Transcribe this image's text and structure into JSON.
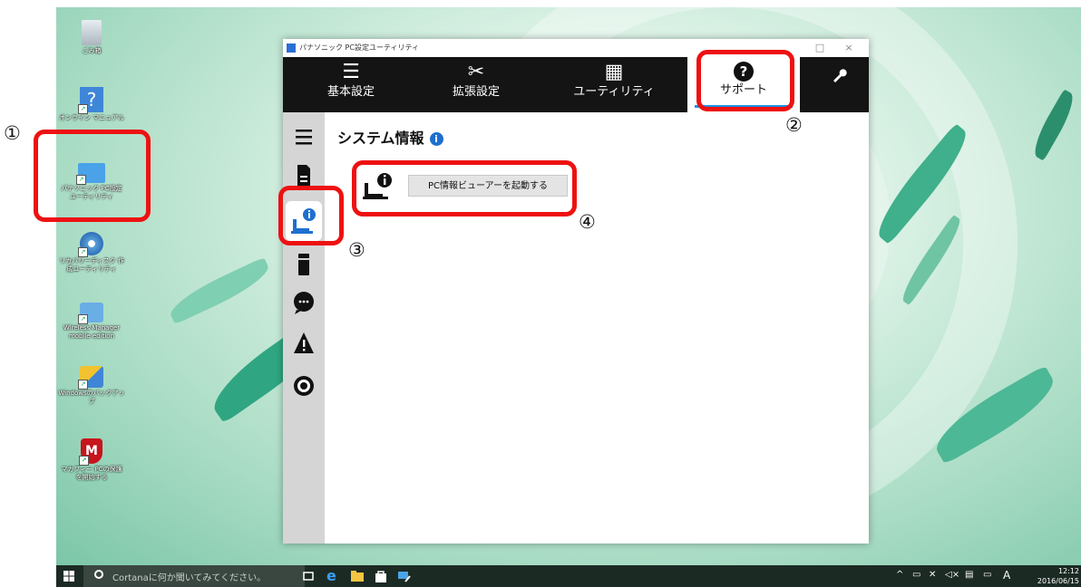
{
  "app": {
    "title": "パナソニック PC設定ユーティリティ",
    "window_controls": {
      "maximize": "□",
      "close": "×"
    }
  },
  "tabs": [
    {
      "label": "基本設定",
      "icon": "sliders-icon",
      "glyph": "☰"
    },
    {
      "label": "拡張設定",
      "icon": "tools-icon",
      "glyph": "✂"
    },
    {
      "label": "ユーティリティ",
      "icon": "grid-icon",
      "glyph": "▦"
    },
    {
      "label": "サポート",
      "icon": "question-icon",
      "glyph": "?"
    },
    {
      "label": "",
      "icon": "wrench-icon",
      "glyph": "🔧"
    }
  ],
  "sidebar": {
    "items": [
      {
        "icon": "menu-icon"
      },
      {
        "icon": "document-icon"
      },
      {
        "icon": "system-info-icon"
      },
      {
        "icon": "device-icon"
      },
      {
        "icon": "chat-icon"
      },
      {
        "icon": "warning-icon"
      },
      {
        "icon": "disc-icon"
      }
    ]
  },
  "content": {
    "section_title": "システム情報",
    "info_glyph": "i",
    "launch_button": "PC情報ビューアーを起動する"
  },
  "desktop_icons": [
    {
      "label": "ごみ箱"
    },
    {
      "label": "オンライン マニュアル"
    },
    {
      "label": "パナソニック PC設定 ユーティリティ"
    },
    {
      "label": "リカバリーディスク 作成ユーティリティ"
    },
    {
      "label": "Wireless Manager mobile edition"
    },
    {
      "label": "Windowsのバックアップ"
    },
    {
      "label": "マカフィー PCの保護を開始する"
    }
  ],
  "markers": [
    "①",
    "②",
    "③",
    "④"
  ],
  "taskbar": {
    "search_placeholder": "Cortanaに何か聞いてみてください。",
    "ime": "A",
    "time": "12:12",
    "date": "2016/06/15"
  },
  "colors": {
    "accent": "#1e90e6",
    "annotation": "#ee1111",
    "tabbar": "#141414",
    "sidebar": "#d5d5d5"
  }
}
